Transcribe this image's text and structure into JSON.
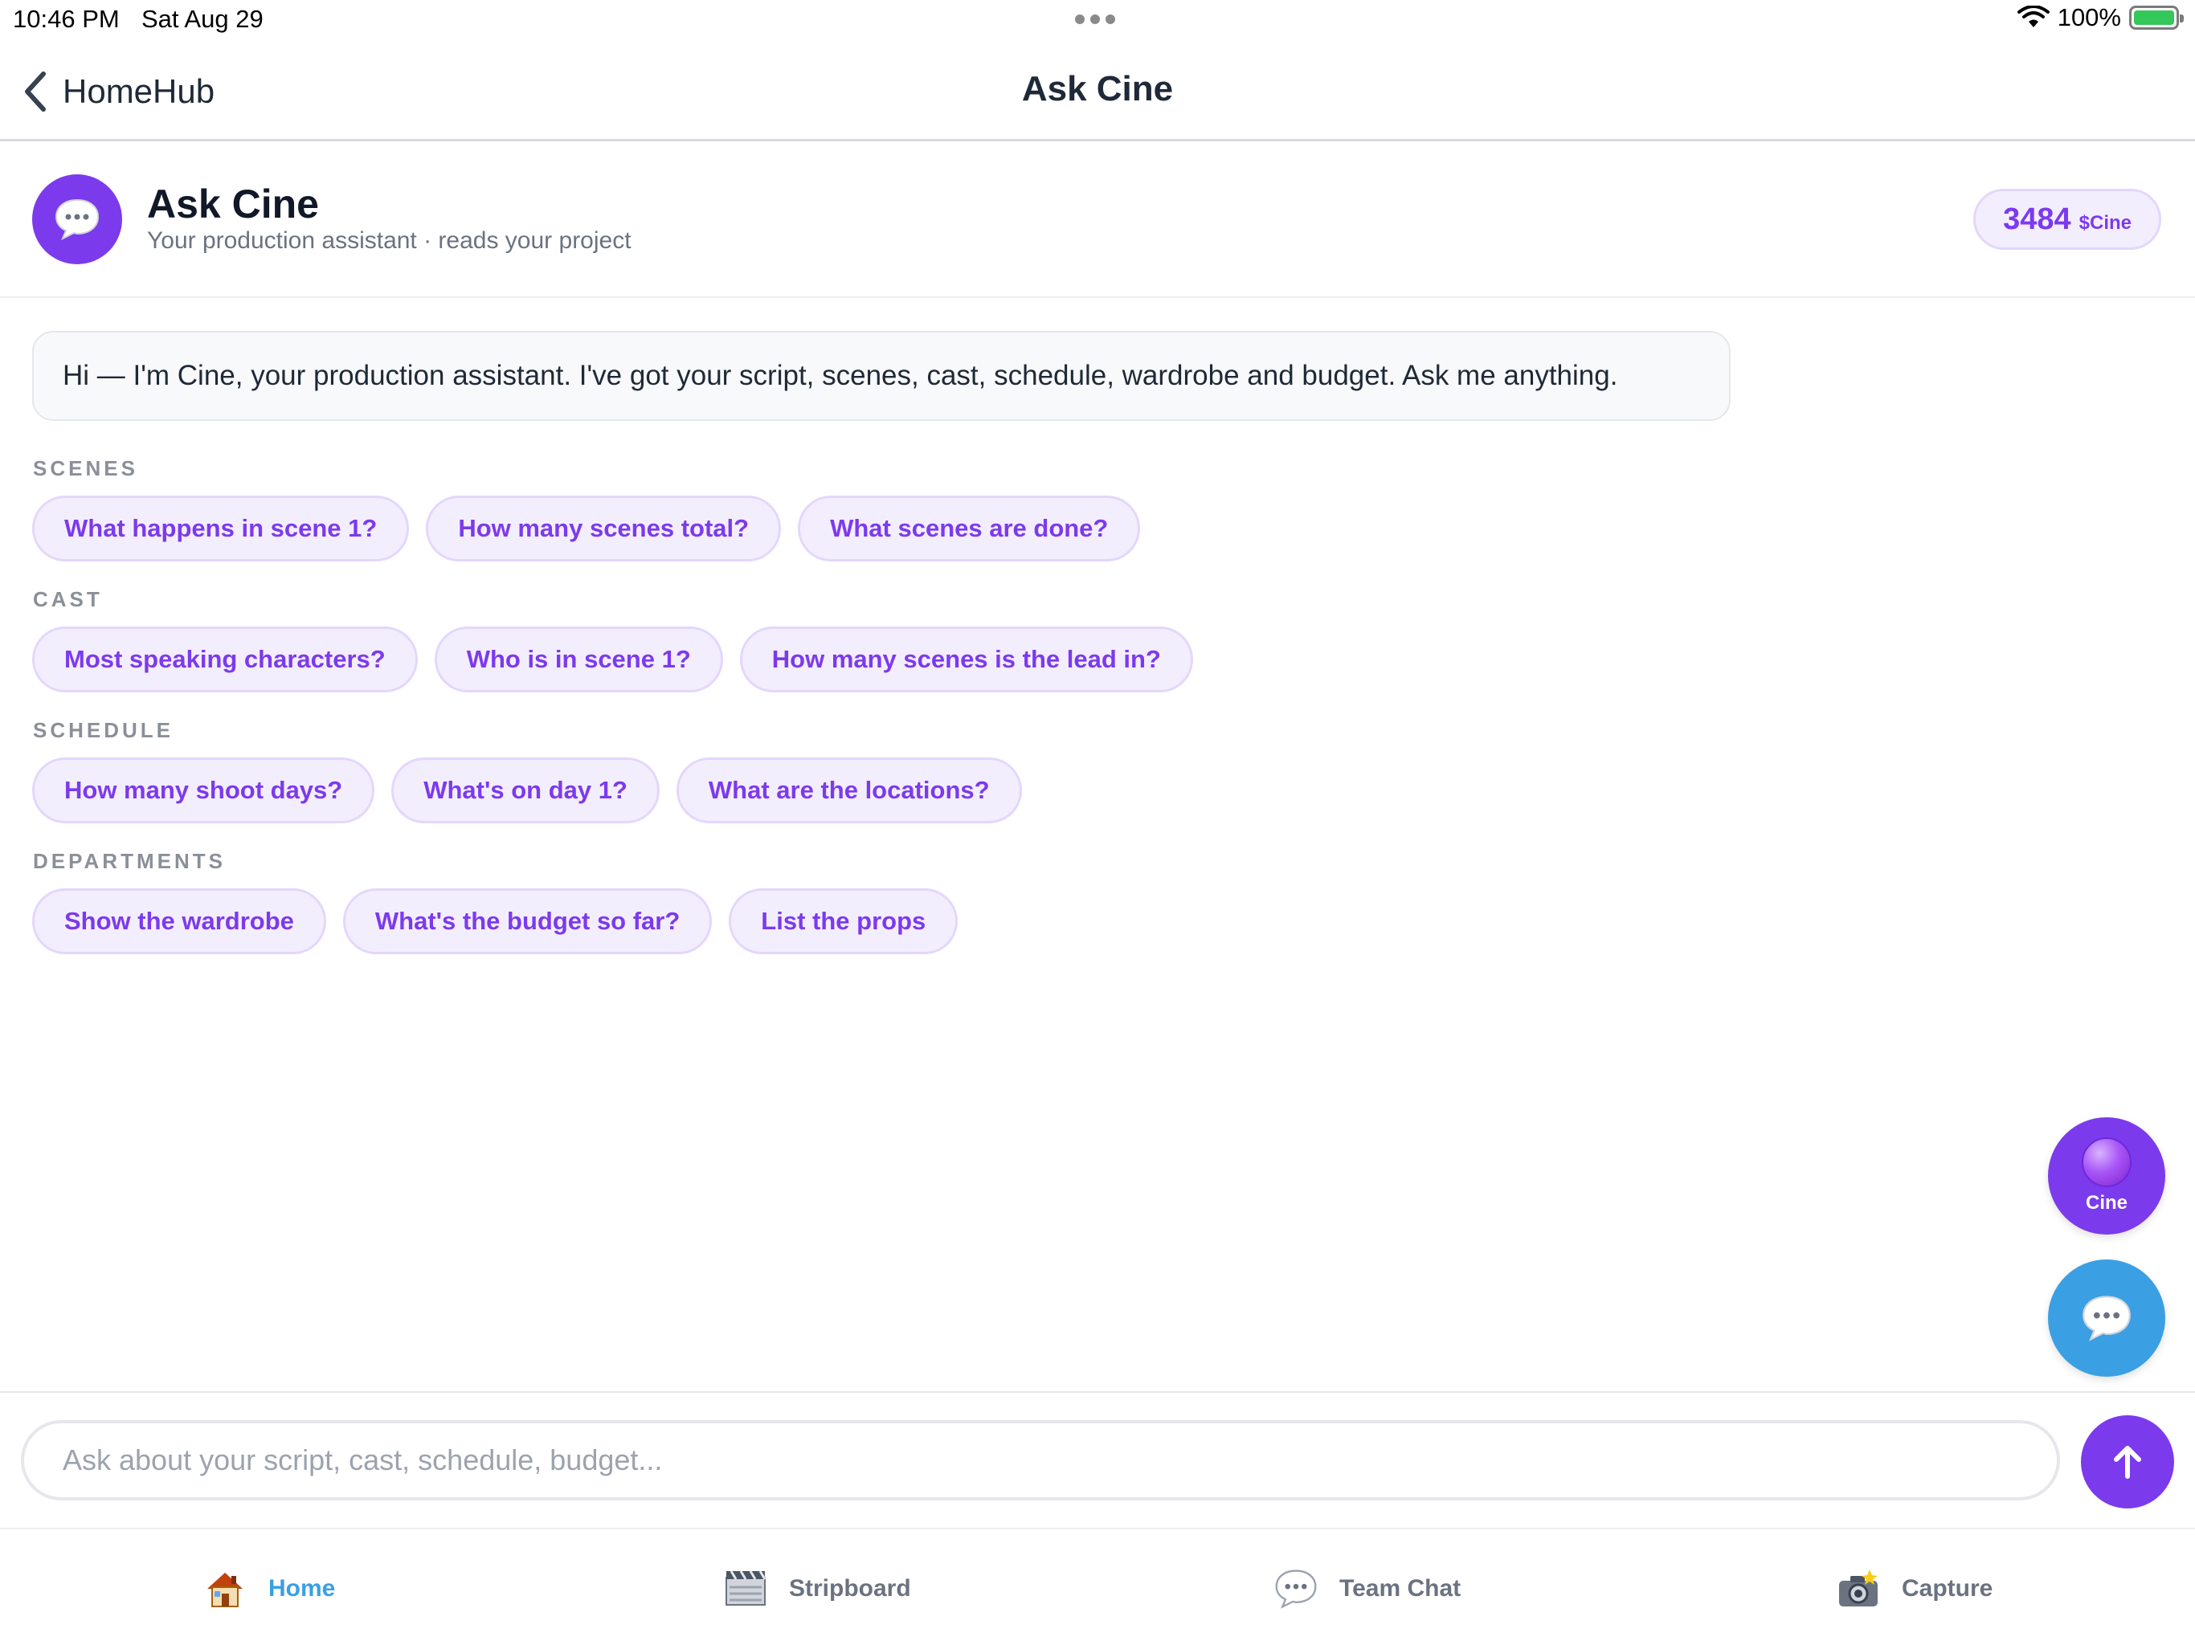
{
  "status_bar": {
    "time": "10:46 PM",
    "date": "Sat Aug 29",
    "battery": "100%"
  },
  "nav": {
    "back_label": "HomeHub",
    "title": "Ask Cine"
  },
  "header": {
    "title": "Ask Cine",
    "subtitle": "Your production assistant · reads your project",
    "token_amount": "3484",
    "token_unit": "$Cine"
  },
  "greeting": "Hi — I'm Cine, your production assistant. I've got your script, scenes, cast, schedule, wardrobe and budget. Ask me anything.",
  "sections": [
    {
      "label": "SCENES",
      "chips": [
        "What happens in scene 1?",
        "How many scenes total?",
        "What scenes are done?"
      ]
    },
    {
      "label": "CAST",
      "chips": [
        "Most speaking characters?",
        "Who is in scene 1?",
        "How many scenes is the lead in?"
      ]
    },
    {
      "label": "SCHEDULE",
      "chips": [
        "How many shoot days?",
        "What's on day 1?",
        "What are the locations?"
      ]
    },
    {
      "label": "DEPARTMENTS",
      "chips": [
        "Show the wardrobe",
        "What's the budget so far?",
        "List the props"
      ]
    }
  ],
  "fab": {
    "cine_label": "Cine"
  },
  "composer": {
    "placeholder": "Ask about your script, cast, schedule, budget..."
  },
  "tabs": [
    {
      "label": "Home",
      "icon": "house-icon",
      "active": true
    },
    {
      "label": "Stripboard",
      "icon": "stripboard-icon",
      "active": false
    },
    {
      "label": "Team Chat",
      "icon": "speech-bubble-icon",
      "active": false
    },
    {
      "label": "Capture",
      "icon": "camera-flash-icon",
      "active": false
    }
  ],
  "colors": {
    "accent": "#7c3aed",
    "chip_background": "#f3eefe",
    "active_tab": "#3b9fe3",
    "chat_fab": "#3b9fe3"
  }
}
